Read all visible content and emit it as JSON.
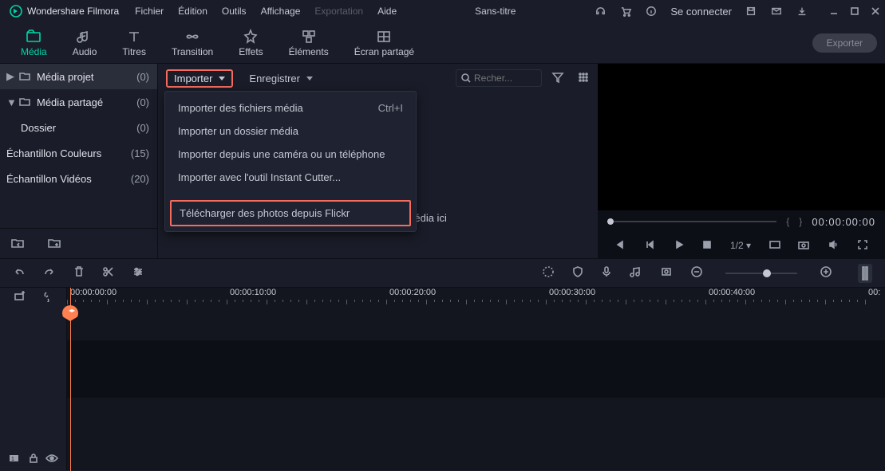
{
  "app": {
    "name": "Wondershare Filmora",
    "title": "Sans-titre",
    "login": "Se connecter"
  },
  "menu": {
    "file": "Fichier",
    "edit": "Édition",
    "tools": "Outils",
    "view": "Affichage",
    "export": "Exportation",
    "help": "Aide"
  },
  "tabs": {
    "media": "Média",
    "audio": "Audio",
    "titles": "Titres",
    "transition": "Transition",
    "effects": "Effets",
    "elements": "Éléments",
    "split": "Écran partagé",
    "exportBtn": "Exporter"
  },
  "sidebar": {
    "items": [
      {
        "label": "Média projet",
        "count": "(0)",
        "sel": true,
        "chev": "▶",
        "folder": true
      },
      {
        "label": "Média partagé",
        "count": "(0)",
        "chev": "▼",
        "folder": true
      },
      {
        "label": "Dossier",
        "count": "(0)",
        "child": true
      },
      {
        "label": "Échantillon Couleurs",
        "count": "(15)"
      },
      {
        "label": "Échantillon Vidéos",
        "count": "(20)"
      }
    ]
  },
  "center": {
    "import": "Importer",
    "record": "Enregistrer",
    "searchPlaceholder": "Recher...",
    "dropdown": {
      "items": [
        {
          "label": "Importer des fichiers média",
          "short": "Ctrl+I"
        },
        {
          "label": "Importer un dossier média"
        },
        {
          "label": "Importer depuis une caméra ou un téléphone"
        },
        {
          "label": "Importer avec l'outil Instant Cutter..."
        }
      ],
      "flickr": "Télécharger des photos depuis Flickr"
    },
    "emptyHint": "Importer des fichiers média ici"
  },
  "preview": {
    "timecode": "00:00:00:00",
    "ratio": "1/2"
  },
  "timeline": {
    "labels": [
      "00:00:00:00",
      "00:00:10:00",
      "00:00:20:00",
      "00:00:30:00",
      "00:00:40:00",
      "00:"
    ]
  }
}
